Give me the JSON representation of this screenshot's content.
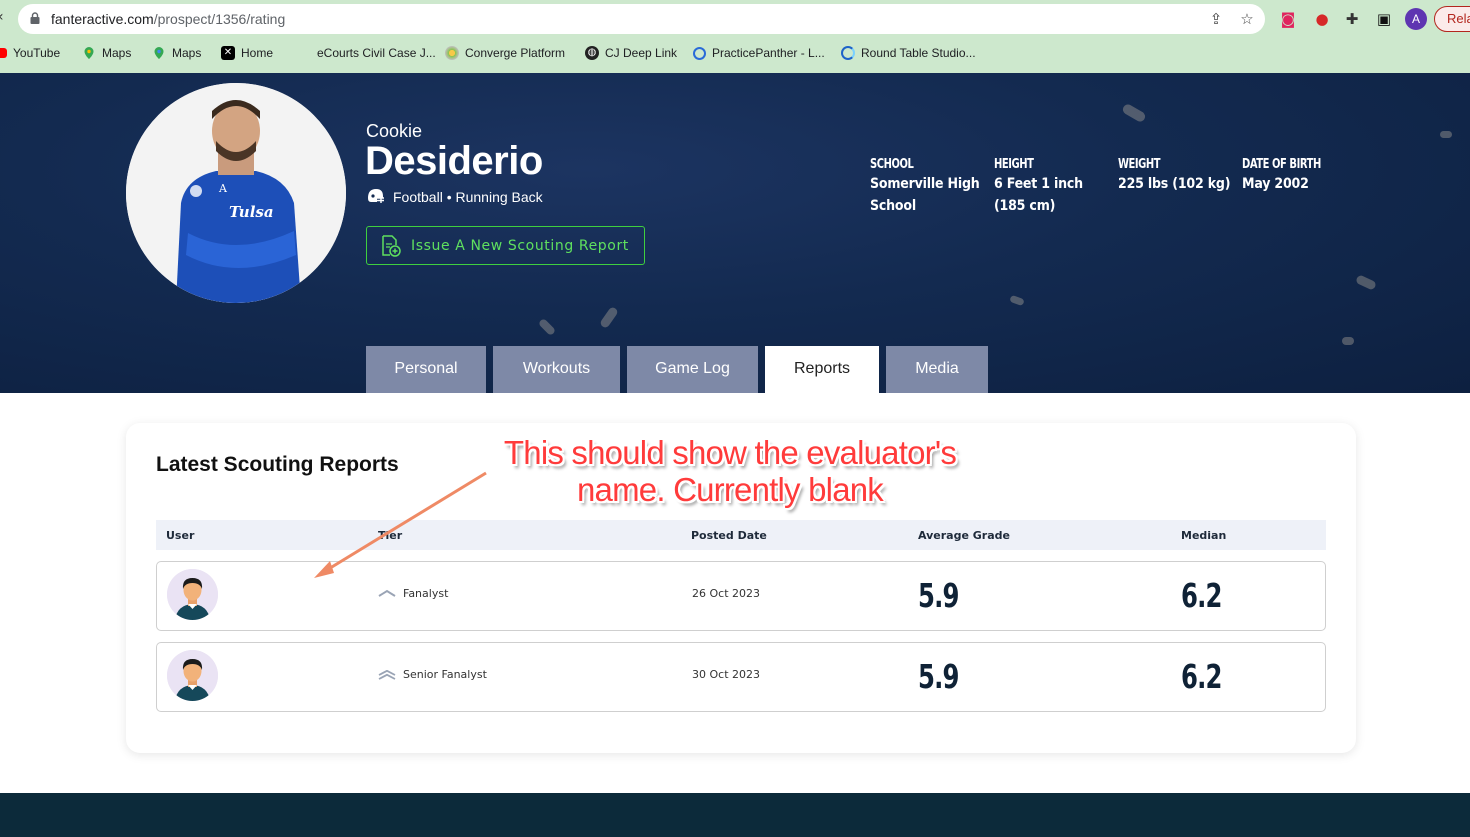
{
  "browser": {
    "url_host": "fanteractive.com",
    "url_path": "/prospect/1356/rating",
    "profile_initial": "A",
    "relaunch_label": "Rela",
    "bookmarks": [
      {
        "label": "YouTube",
        "icon": "youtube-icon",
        "color": "#ff0000"
      },
      {
        "label": "Maps",
        "icon": "maps-pin-icon",
        "color": "#34a853"
      },
      {
        "label": "Maps",
        "icon": "maps-pin-icon",
        "color": "#34a853"
      },
      {
        "label": "Home",
        "icon": "x-logo-icon",
        "color": "#000000"
      },
      {
        "label": "eCourts Civil Case J...",
        "icon": "",
        "color": ""
      },
      {
        "label": "Converge Platform",
        "icon": "converge-icon",
        "color": "#8bc34a"
      },
      {
        "label": "CJ Deep Link",
        "icon": "globe-icon",
        "color": "#222222"
      },
      {
        "label": "PracticePanther - L...",
        "icon": "practicepanther-icon",
        "color": "#2a6bd8"
      },
      {
        "label": "Round Table Studio...",
        "icon": "round-table-icon",
        "color": "#1e63c9"
      }
    ]
  },
  "profile": {
    "first_name": "Cookie",
    "last_name": "Desiderio",
    "sport_line": "Football • Running Back",
    "issue_button_label": "Issue A New Scouting Report",
    "stats": [
      {
        "label": "SCHOOL",
        "value": "Somerville High School"
      },
      {
        "label": "HEIGHT",
        "value": "6 Feet 1 inch (185 cm)"
      },
      {
        "label": "WEIGHT",
        "value": "225 lbs (102 kg)"
      },
      {
        "label": "DATE OF BIRTH",
        "value": "May 2002"
      }
    ],
    "tabs": [
      {
        "label": "Personal",
        "active": false
      },
      {
        "label": "Workouts",
        "active": false
      },
      {
        "label": "Game Log",
        "active": false
      },
      {
        "label": "Reports",
        "active": true
      },
      {
        "label": "Media",
        "active": false
      }
    ]
  },
  "reports": {
    "title": "Latest Scouting Reports",
    "columns": [
      "User",
      "Tier",
      "Posted Date",
      "Average Grade",
      "Median"
    ],
    "rows": [
      {
        "user": "",
        "tier": "Fanalyst",
        "posted_date": "26 Oct 2023",
        "average_grade": "5.9",
        "median": "6.2"
      },
      {
        "user": "",
        "tier": "Senior Fanalyst",
        "posted_date": "30 Oct 2023",
        "average_grade": "5.9",
        "median": "6.2"
      }
    ]
  },
  "annotation": {
    "line1": "This should show the evaluator's",
    "line2": "name. Currently blank",
    "color": "#ff3b3b"
  },
  "colors": {
    "accent_green": "#3fcf3f",
    "hero_navy": "#132a50",
    "tab_inactive": "#7e89a7",
    "footer": "#0c2a3a"
  }
}
